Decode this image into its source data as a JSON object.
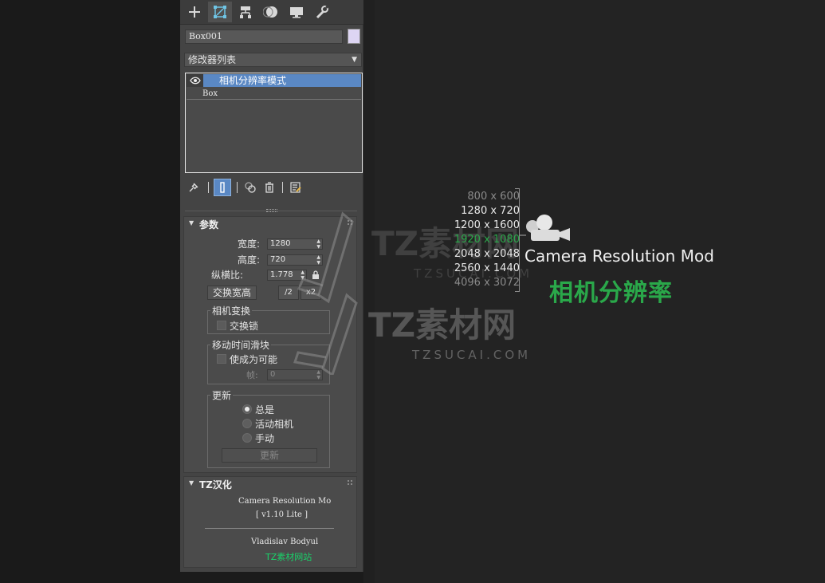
{
  "tabs": [
    {
      "name": "create-tab",
      "icon": "plus-icon"
    },
    {
      "name": "modify-tab",
      "icon": "modify-icon"
    },
    {
      "name": "hierarchy-tab",
      "icon": "hierarchy-icon"
    },
    {
      "name": "motion-tab",
      "icon": "motion-icon"
    },
    {
      "name": "display-tab",
      "icon": "display-icon"
    },
    {
      "name": "utilities-tab",
      "icon": "wrench-icon"
    }
  ],
  "object": {
    "name": "Box001",
    "color": "#ddd5f3"
  },
  "modifier_list": {
    "label": "修改器列表"
  },
  "stack": {
    "items": [
      {
        "label": "相机分辨率模式",
        "selected": true
      },
      {
        "label": "Box",
        "selected": false
      }
    ]
  },
  "params": {
    "title": "参数",
    "width_label": "宽度:",
    "width_value": "1280",
    "height_label": "高度:",
    "height_value": "720",
    "aspect_label": "纵横比:",
    "aspect_value": "1.778",
    "swap_button": "交换宽高",
    "half_button": "/2",
    "double_button": "x2",
    "camera_transform_group": "相机变换",
    "transform_lock_label": "交换锁",
    "time_slider_group": "移动时间滑块",
    "enable_label": "使成为可能",
    "frame_label": "帧:",
    "frame_value": "0",
    "update_group": "更新",
    "update_options": [
      "总是",
      "活动相机",
      "手动"
    ],
    "update_selected": 0,
    "update_button": "更新"
  },
  "about": {
    "title": "TZ汉化",
    "line1": "Camera Resolution Mo",
    "line2": "[ v1.10 Lite ]",
    "author": "Vladislav Bodyul",
    "site": "TZ素材网站",
    "site_color": "#19d36a"
  },
  "artwork": {
    "resolutions": [
      {
        "text": "800 x 600",
        "color": "#8a8a8a"
      },
      {
        "text": "1280 x 720",
        "color": "#e8e8e8"
      },
      {
        "text": "1200 x 1600",
        "color": "#e8e8e8"
      },
      {
        "text": "1920 x 1080",
        "color": "#2aa84a"
      },
      {
        "text": "2048 x 2048",
        "color": "#e8e8e8"
      },
      {
        "text": "2560 x 1440",
        "color": "#e8e8e8"
      },
      {
        "text": "4096 x 3072",
        "color": "#8a8a8a"
      }
    ],
    "title_en": "Camera Resolution Mod",
    "title_cn": "相机分辨率",
    "watermark_main": "TZ素材网",
    "watermark_sub": "TZSUCAI.COM"
  }
}
